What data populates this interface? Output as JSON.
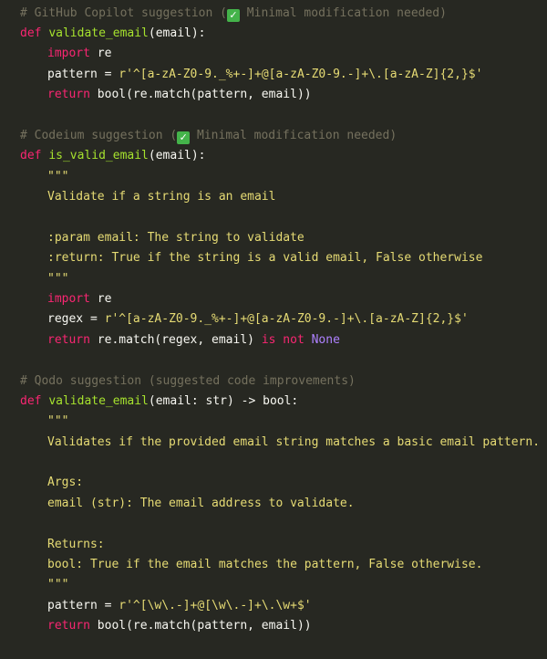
{
  "blocks": [
    {
      "comment": {
        "before": "# GitHub Copilot suggestion (",
        "icon": "check-mark-icon",
        "icon_glyph": "✓",
        "after": " Minimal modification needed)"
      },
      "signature": {
        "def": "def",
        "name": "validate_email",
        "params": "(email):"
      },
      "lines": {
        "import_kw": "import",
        "import_mod": " re",
        "pattern_lhs": "pattern = ",
        "pattern_str": "r'^[a-zA-Z0-9._%+-]+@[a-zA-Z0-9.-]+\\.[a-zA-Z]{2,}$'",
        "return_kw": "return",
        "return_expr": " bool(re.match(pattern, email))"
      }
    },
    {
      "comment": {
        "before": "# Codeium suggestion (",
        "icon": "check-mark-icon",
        "icon_glyph": "✓",
        "after": " Minimal modification needed)"
      },
      "signature": {
        "def": "def",
        "name": "is_valid_email",
        "params": "(email):"
      },
      "lines": {
        "doc_open": "\"\"\"",
        "doc_summary": "Validate if a string is an email",
        "doc_param": ":param email: The string to validate",
        "doc_return": ":return: True if the string is a valid email, False otherwise",
        "doc_close": "\"\"\"",
        "import_kw": "import",
        "import_mod": " re",
        "regex_lhs": "regex = ",
        "regex_str": "r'^[a-zA-Z0-9._%+-]+@[a-zA-Z0-9.-]+\\.[a-zA-Z]{2,}$'",
        "return_kw": "return",
        "return_expr": " re.match(regex, email) ",
        "is_not_kw": "is not",
        "none_const": "None"
      }
    },
    {
      "comment": {
        "text": "# Qodo suggestion (suggested code improvements)"
      },
      "signature": {
        "def": "def",
        "name": "validate_email",
        "params": "(email: str) -> bool:"
      },
      "lines": {
        "doc_open": "\"\"\"",
        "doc_summary": "Validates if the provided email string matches a basic email pattern.",
        "doc_args_header": "Args:",
        "doc_args_email": "email (str): The email address to validate.",
        "doc_returns_header": "Returns:",
        "doc_returns_bool": "bool: True if the email matches the pattern, False otherwise.",
        "doc_close": "\"\"\"",
        "pattern_lhs": "pattern = ",
        "pattern_str": "r'^[\\w\\.-]+@[\\w\\.-]+\\.\\w+$'",
        "return_kw": "return",
        "return_expr": " bool(re.match(pattern, email))"
      }
    }
  ],
  "colors": {
    "background": "#272822",
    "comment": "#75715e",
    "keyword": "#f92672",
    "function": "#a6e22e",
    "string": "#e6db74",
    "constant": "#ae81ff",
    "text": "#f8f8f2",
    "check_badge": "#44b34a"
  }
}
